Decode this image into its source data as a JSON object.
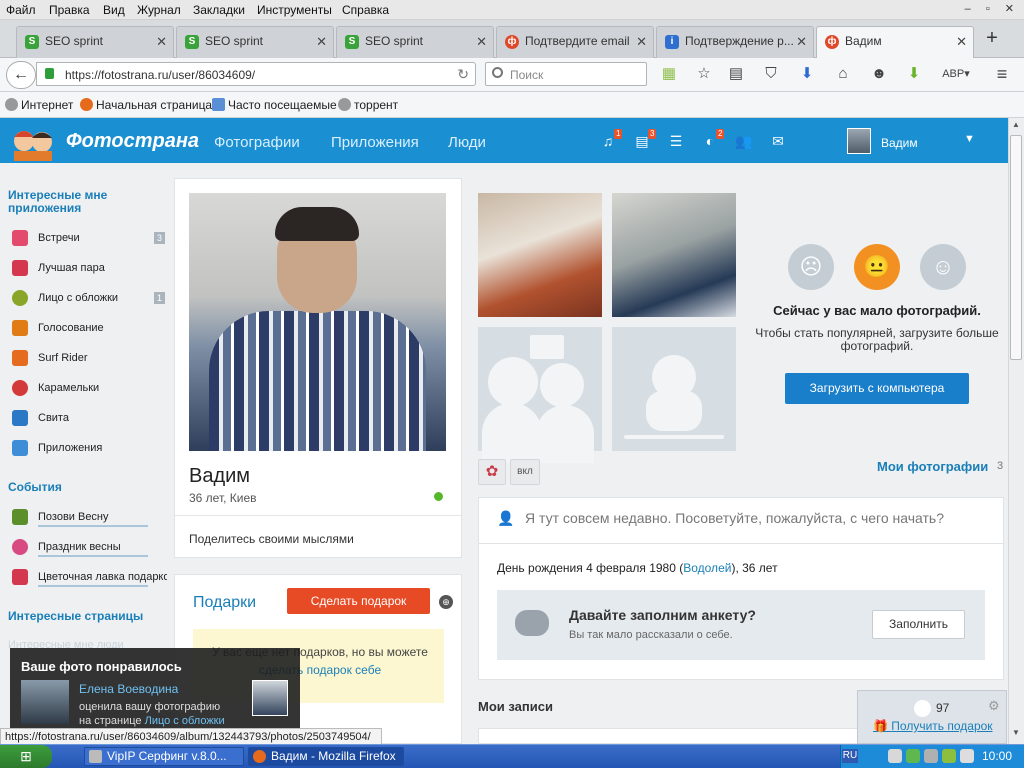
{
  "menubar": [
    "Файл",
    "Правка",
    "Вид",
    "Журнал",
    "Закладки",
    "Инструменты",
    "Справка"
  ],
  "tabs": [
    {
      "label": "SEO sprint",
      "icon": "seosprint-icon"
    },
    {
      "label": "SEO sprint",
      "icon": "seosprint-icon"
    },
    {
      "label": "SEO sprint",
      "icon": "seosprint-icon"
    },
    {
      "label": "Подтвердите email",
      "icon": "fotostrana-icon"
    },
    {
      "label": "Подтверждение р...",
      "icon": "info-icon"
    },
    {
      "label": "Вадим",
      "icon": "fotostrana-icon",
      "active": true
    }
  ],
  "tab_close": "✕",
  "newtab_label": "+",
  "url": "https://fotostrana.ru/user/86034609/",
  "search_placeholder": "Поиск",
  "bookmarks": [
    "Интернет",
    "Начальная страница",
    "Часто посещаемые",
    "торрент"
  ],
  "site": {
    "logo": "Фотострана",
    "nav": [
      "Фотографии",
      "Приложения",
      "Люди"
    ],
    "badges": {
      "music": "1",
      "feed": "3",
      "events": "2"
    },
    "user_name": "Вадим"
  },
  "sidebar": {
    "apps_title": "Интересные мне приложения",
    "apps": [
      {
        "label": "Встречи",
        "count": "3",
        "color": "#e24b6b"
      },
      {
        "label": "Лучшая пара",
        "count": "",
        "color": "#d4384f"
      },
      {
        "label": "Лицо с обложки",
        "count": "1",
        "color": "#8aa629"
      },
      {
        "label": "Голосование",
        "count": "",
        "color": "#e07b16"
      },
      {
        "label": "Surf Rider",
        "count": "",
        "color": "#e56b1f"
      },
      {
        "label": "Карамельки",
        "count": "",
        "color": "#d43a3a"
      },
      {
        "label": "Свита",
        "count": "",
        "color": "#2a78c6"
      },
      {
        "label": "Приложения",
        "count": "",
        "color": "#3d8ed6"
      }
    ],
    "events_title": "События",
    "events": [
      {
        "label": "Позови Весну",
        "color": "#5a8f2b"
      },
      {
        "label": "Праздник весны",
        "color": "#d84a82"
      },
      {
        "label": "Цветочная лавка подарков",
        "color": "#d4384f"
      }
    ],
    "pages_title": "Интересные страницы",
    "people_title": "Интересные мне люди",
    "people_hint": "Введите имя или фам"
  },
  "profile": {
    "name": "Вадим",
    "info": "36 лет, Киев",
    "thoughts": "Поделитесь своими мыслями"
  },
  "gifts": {
    "title": "Подарки",
    "button": "Сделать подарок",
    "globe": "⊕",
    "text_before": "У вас еще нет подарков, но вы можете",
    "link": "сделать подарок себе"
  },
  "photos": {
    "low_title": "Сейчас у вас мало фотографий.",
    "low_text": "Чтобы стать популярней, загрузите больше фотографий.",
    "upload_button": "Загрузить с компьютера",
    "toggle": "вкл",
    "my_photos": "Мои фотографии",
    "count": "3"
  },
  "status": {
    "text": "Я тут совсем недавно. Посоветуйте, пожалуйста, с чего начать?"
  },
  "about": {
    "bday_prefix": "День рождения 4 февраля 1980 (",
    "zodiac": "Водолей",
    "bday_suffix": "), 36 лет",
    "fill_title": "Давайте заполним анкету?",
    "fill_sub": "Вы так мало рассказали о себе.",
    "fill_button": "Заполнить"
  },
  "posts_title": "Мои записи",
  "notification": {
    "title": "Ваше фото понравилось",
    "user": "Елена Воеводина",
    "text": "оценила вашу фотографию",
    "text2_prefix": "на странице ",
    "link": "Лицо с обложки"
  },
  "widget": {
    "coins": "97",
    "gift_link": "Получить подарок"
  },
  "status_url": "https://fotostrana.ru/user/86034609/album/132443793/photos/2503749504/",
  "taskbar": {
    "start": "⊞",
    "tasks": [
      "VipIP Серфинг  v.8.0...",
      "Вадим - Mozilla Firefox"
    ],
    "lang": "RU",
    "clock": "10:00"
  }
}
